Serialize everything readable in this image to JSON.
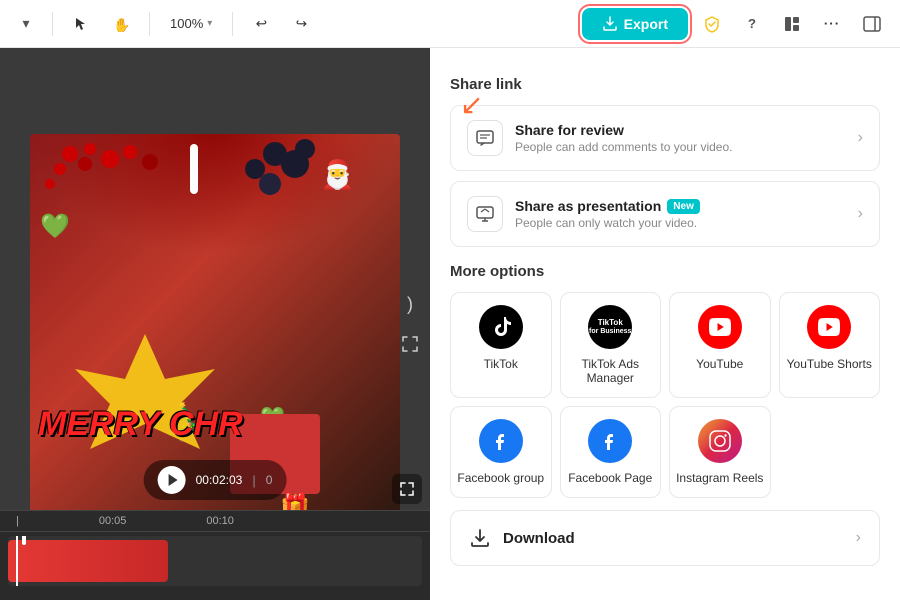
{
  "toolbar": {
    "zoom_level": "100%",
    "export_label": "Export",
    "undo_icon": "↩",
    "redo_icon": "↪",
    "chevron_icon": "❯"
  },
  "video": {
    "timestamp": "00:02:03",
    "merry_text": "MERRY CHR"
  },
  "timeline": {
    "mark1": "00:05",
    "mark2": "00:10"
  },
  "export_panel": {
    "share_link_title": "Share link",
    "share_review_title": "Share for review",
    "share_review_desc": "People can add comments to your video.",
    "share_presentation_title": "Share as presentation",
    "share_presentation_desc": "People can only watch your video.",
    "new_badge": "New",
    "more_options_title": "More options",
    "platforms": [
      {
        "id": "tiktok",
        "label": "TikTok",
        "type": "tiktok"
      },
      {
        "id": "tiktok-ads",
        "label": "TikTok Ads Manager",
        "type": "tiktok-ads"
      },
      {
        "id": "youtube",
        "label": "YouTube",
        "type": "youtube"
      },
      {
        "id": "youtube-shorts",
        "label": "YouTube Shorts",
        "type": "youtube-shorts"
      },
      {
        "id": "facebook-group",
        "label": "Facebook group",
        "type": "facebook"
      },
      {
        "id": "facebook-page",
        "label": "Facebook Page",
        "type": "facebook"
      },
      {
        "id": "instagram-reels",
        "label": "Instagram Reels",
        "type": "instagram"
      }
    ],
    "download_label": "Download"
  }
}
